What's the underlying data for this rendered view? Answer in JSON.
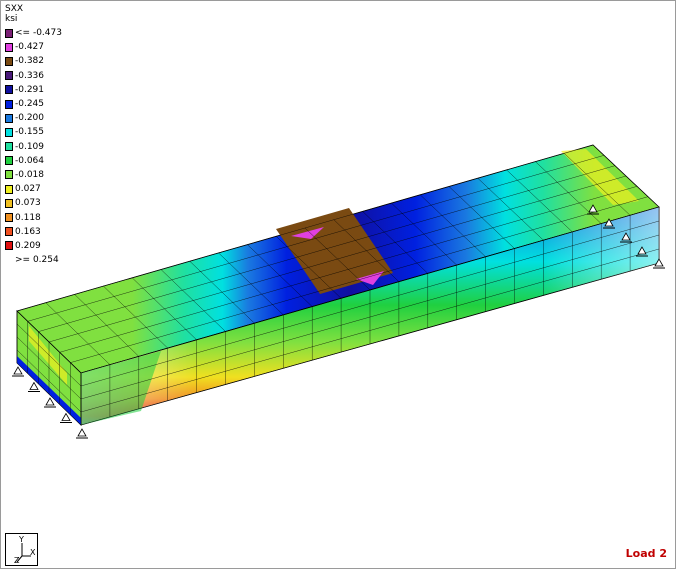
{
  "legend": {
    "quantity": "SXX",
    "unit": "ksi",
    "items": [
      {
        "label": "<= -0.473",
        "color": "#7a1f74"
      },
      {
        "label": "-0.427",
        "color": "#e040e0"
      },
      {
        "label": "-0.382",
        "color": "#7a4a12"
      },
      {
        "label": "-0.336",
        "color": "#4a1a7a"
      },
      {
        "label": "-0.291",
        "color": "#1010a0"
      },
      {
        "label": "-0.245",
        "color": "#0020e0"
      },
      {
        "label": "-0.200",
        "color": "#1a7ae0"
      },
      {
        "label": "-0.155",
        "color": "#00e0e0"
      },
      {
        "label": "-0.109",
        "color": "#20e0a0"
      },
      {
        "label": "-0.064",
        "color": "#20d040"
      },
      {
        "label": "-0.018",
        "color": "#80e040"
      },
      {
        "label": "0.027",
        "color": "#f0f020"
      },
      {
        "label": "0.073",
        "color": "#f0c020"
      },
      {
        "label": "0.118",
        "color": "#f09020"
      },
      {
        "label": "0.163",
        "color": "#f05020"
      },
      {
        "label": "0.209",
        "color": "#e01010"
      },
      {
        "label": ">= 0.254",
        "color": ""
      }
    ]
  },
  "triad": {
    "y": "Y",
    "x": "X",
    "z": "Z"
  },
  "load_case": "Load 2"
}
